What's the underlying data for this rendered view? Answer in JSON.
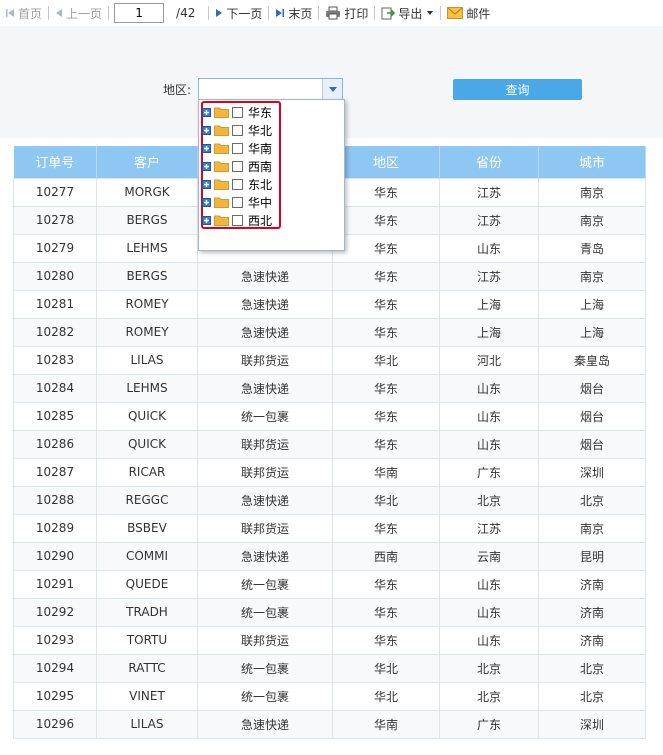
{
  "toolbar": {
    "first": "首页",
    "prev": "上一页",
    "page_value": "1",
    "page_total": "/42",
    "next": "下一页",
    "last": "末页",
    "print": "打印",
    "export": "导出",
    "mail": "邮件"
  },
  "params": {
    "region_label": "地区:",
    "region_value": "",
    "query_button": "查询"
  },
  "dropdown": {
    "items": [
      "华东",
      "华北",
      "华南",
      "西南",
      "东北",
      "华中",
      "西北"
    ]
  },
  "table": {
    "headers": [
      "订单号",
      "客户",
      "",
      "地区",
      "省份",
      "城市"
    ],
    "rows": [
      [
        "10277",
        "MORGK",
        "",
        "华东",
        "江苏",
        "南京"
      ],
      [
        "10278",
        "BERGS",
        "",
        "华东",
        "江苏",
        "南京"
      ],
      [
        "10279",
        "LEHMS",
        "",
        "华东",
        "山东",
        "青岛"
      ],
      [
        "10280",
        "BERGS",
        "急速快递",
        "华东",
        "江苏",
        "南京"
      ],
      [
        "10281",
        "ROMEY",
        "急速快递",
        "华东",
        "上海",
        "上海"
      ],
      [
        "10282",
        "ROMEY",
        "急速快递",
        "华东",
        "上海",
        "上海"
      ],
      [
        "10283",
        "LILAS",
        "联邦货运",
        "华北",
        "河北",
        "秦皇岛"
      ],
      [
        "10284",
        "LEHMS",
        "急速快递",
        "华东",
        "山东",
        "烟台"
      ],
      [
        "10285",
        "QUICK",
        "统一包裹",
        "华东",
        "山东",
        "烟台"
      ],
      [
        "10286",
        "QUICK",
        "联邦货运",
        "华东",
        "山东",
        "烟台"
      ],
      [
        "10287",
        "RICAR",
        "联邦货运",
        "华南",
        "广东",
        "深圳"
      ],
      [
        "10288",
        "REGGC",
        "急速快递",
        "华北",
        "北京",
        "北京"
      ],
      [
        "10289",
        "BSBEV",
        "联邦货运",
        "华东",
        "江苏",
        "南京"
      ],
      [
        "10290",
        "COMMI",
        "急速快递",
        "西南",
        "云南",
        "昆明"
      ],
      [
        "10291",
        "QUEDE",
        "统一包裹",
        "华东",
        "山东",
        "济南"
      ],
      [
        "10292",
        "TRADH",
        "统一包裹",
        "华东",
        "山东",
        "济南"
      ],
      [
        "10293",
        "TORTU",
        "联邦货运",
        "华东",
        "山东",
        "济南"
      ],
      [
        "10294",
        "RATTC",
        "统一包裹",
        "华北",
        "北京",
        "北京"
      ],
      [
        "10295",
        "VINET",
        "统一包裹",
        "华北",
        "北京",
        "北京"
      ],
      [
        "10296",
        "LILAS",
        "急速快递",
        "华南",
        "广东",
        "深圳"
      ]
    ]
  },
  "colors": {
    "header_bg": "#8dc7f2",
    "query_button": "#4aa7e8",
    "highlight_box": "#e0001b",
    "folder": "#f2b640"
  },
  "icons": {
    "first": "first-page-icon",
    "prev": "prev-page-icon",
    "next": "next-page-icon",
    "last": "last-page-icon",
    "print": "printer-icon",
    "export": "export-icon",
    "mail": "mail-icon"
  }
}
